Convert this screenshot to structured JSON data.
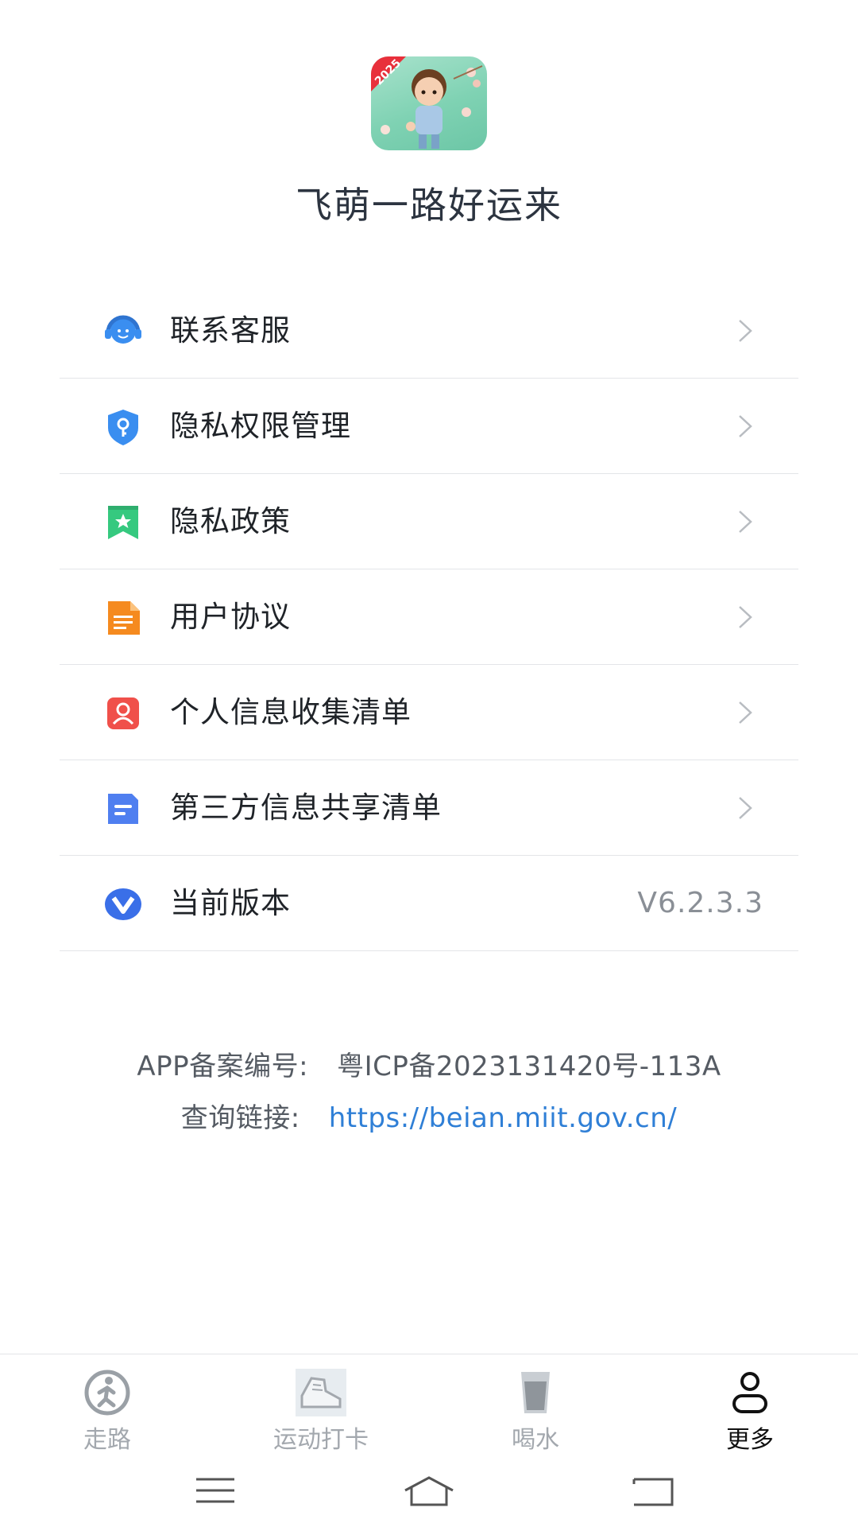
{
  "header": {
    "app_icon_badge": "2025",
    "app_name": "飞萌一路好运来"
  },
  "menu": {
    "items": [
      {
        "label": "联系客服",
        "icon": "customer-service-headset-icon",
        "color": "#3a8ef0"
      },
      {
        "label": "隐私权限管理",
        "icon": "shield-key-icon",
        "color": "#3a8ef0"
      },
      {
        "label": "隐私政策",
        "icon": "bookmark-star-icon",
        "color": "#35c97f"
      },
      {
        "label": "用户协议",
        "icon": "document-icon",
        "color": "#f58a1f"
      },
      {
        "label": "个人信息收集清单",
        "icon": "person-card-icon",
        "color": "#f0504a"
      },
      {
        "label": "第三方信息共享清单",
        "icon": "file-lines-icon",
        "color": "#4f7ff0"
      }
    ],
    "version": {
      "label": "当前版本",
      "value": "V6.2.3.3",
      "icon": "v-logo-icon",
      "color": "#3a6fe8"
    }
  },
  "filing": {
    "icp_label": "APP备案编号:",
    "icp_value": "粤ICP备2023131420号-113A",
    "query_label": "查询链接:",
    "query_link": "https://beian.miit.gov.cn/"
  },
  "tabbar": {
    "tabs": [
      {
        "label": "走路",
        "icon": "walking-person-icon",
        "active": false
      },
      {
        "label": "运动打卡",
        "icon": "sneaker-icon",
        "active": false
      },
      {
        "label": "喝水",
        "icon": "water-glass-icon",
        "active": false
      },
      {
        "label": "更多",
        "icon": "user-profile-icon",
        "active": true
      }
    ]
  },
  "system_nav": {
    "buttons": [
      "menu-icon",
      "home-icon",
      "back-icon"
    ]
  }
}
